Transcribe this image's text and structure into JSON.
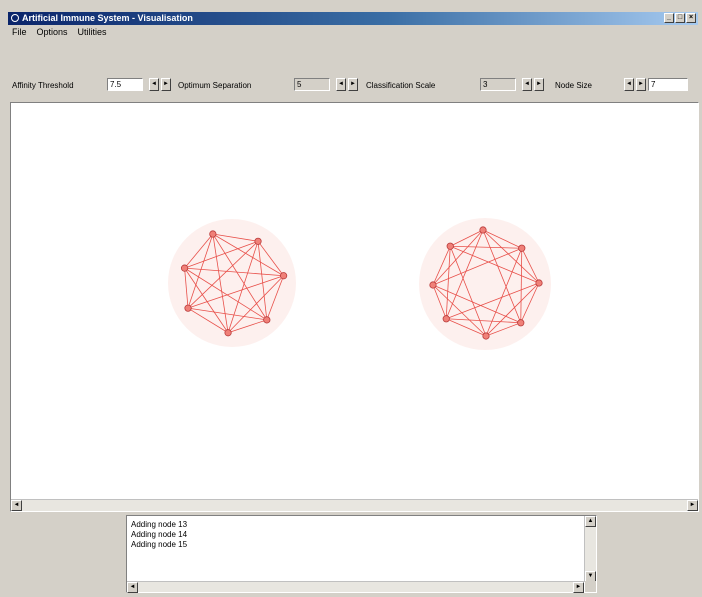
{
  "window": {
    "title": "Artificial Immune System - Visualisation",
    "controls": {
      "minimize": "_",
      "maximize": "□",
      "close": "×"
    }
  },
  "menu": {
    "items": [
      "File",
      "Options",
      "Utilities"
    ]
  },
  "toolbar": {
    "affinity_label": "Affinity Threshold",
    "affinity_value": "7.5",
    "optimum_label": "Optimum Separation",
    "optimum_value": "5",
    "classification_label": "Classification Scale",
    "classification_value": "3",
    "node_size_label": "Node Size",
    "node_size_value": "7",
    "spin_down_glyph": "◄",
    "spin_up_glyph": "►"
  },
  "log": {
    "lines": [
      "Adding node 13",
      "Adding node 14",
      "Adding node 15"
    ]
  },
  "colors": {
    "edge": "#e8504a",
    "node_fill": "#f08078",
    "node_stroke": "#b83a3a",
    "glow": "#fbe4e0"
  },
  "icons": {
    "app": "app-icon",
    "scroll_left": "arrow-left-icon",
    "scroll_right": "arrow-right-icon",
    "scroll_up": "arrow-up-icon",
    "scroll_down": "arrow-down-icon"
  }
}
